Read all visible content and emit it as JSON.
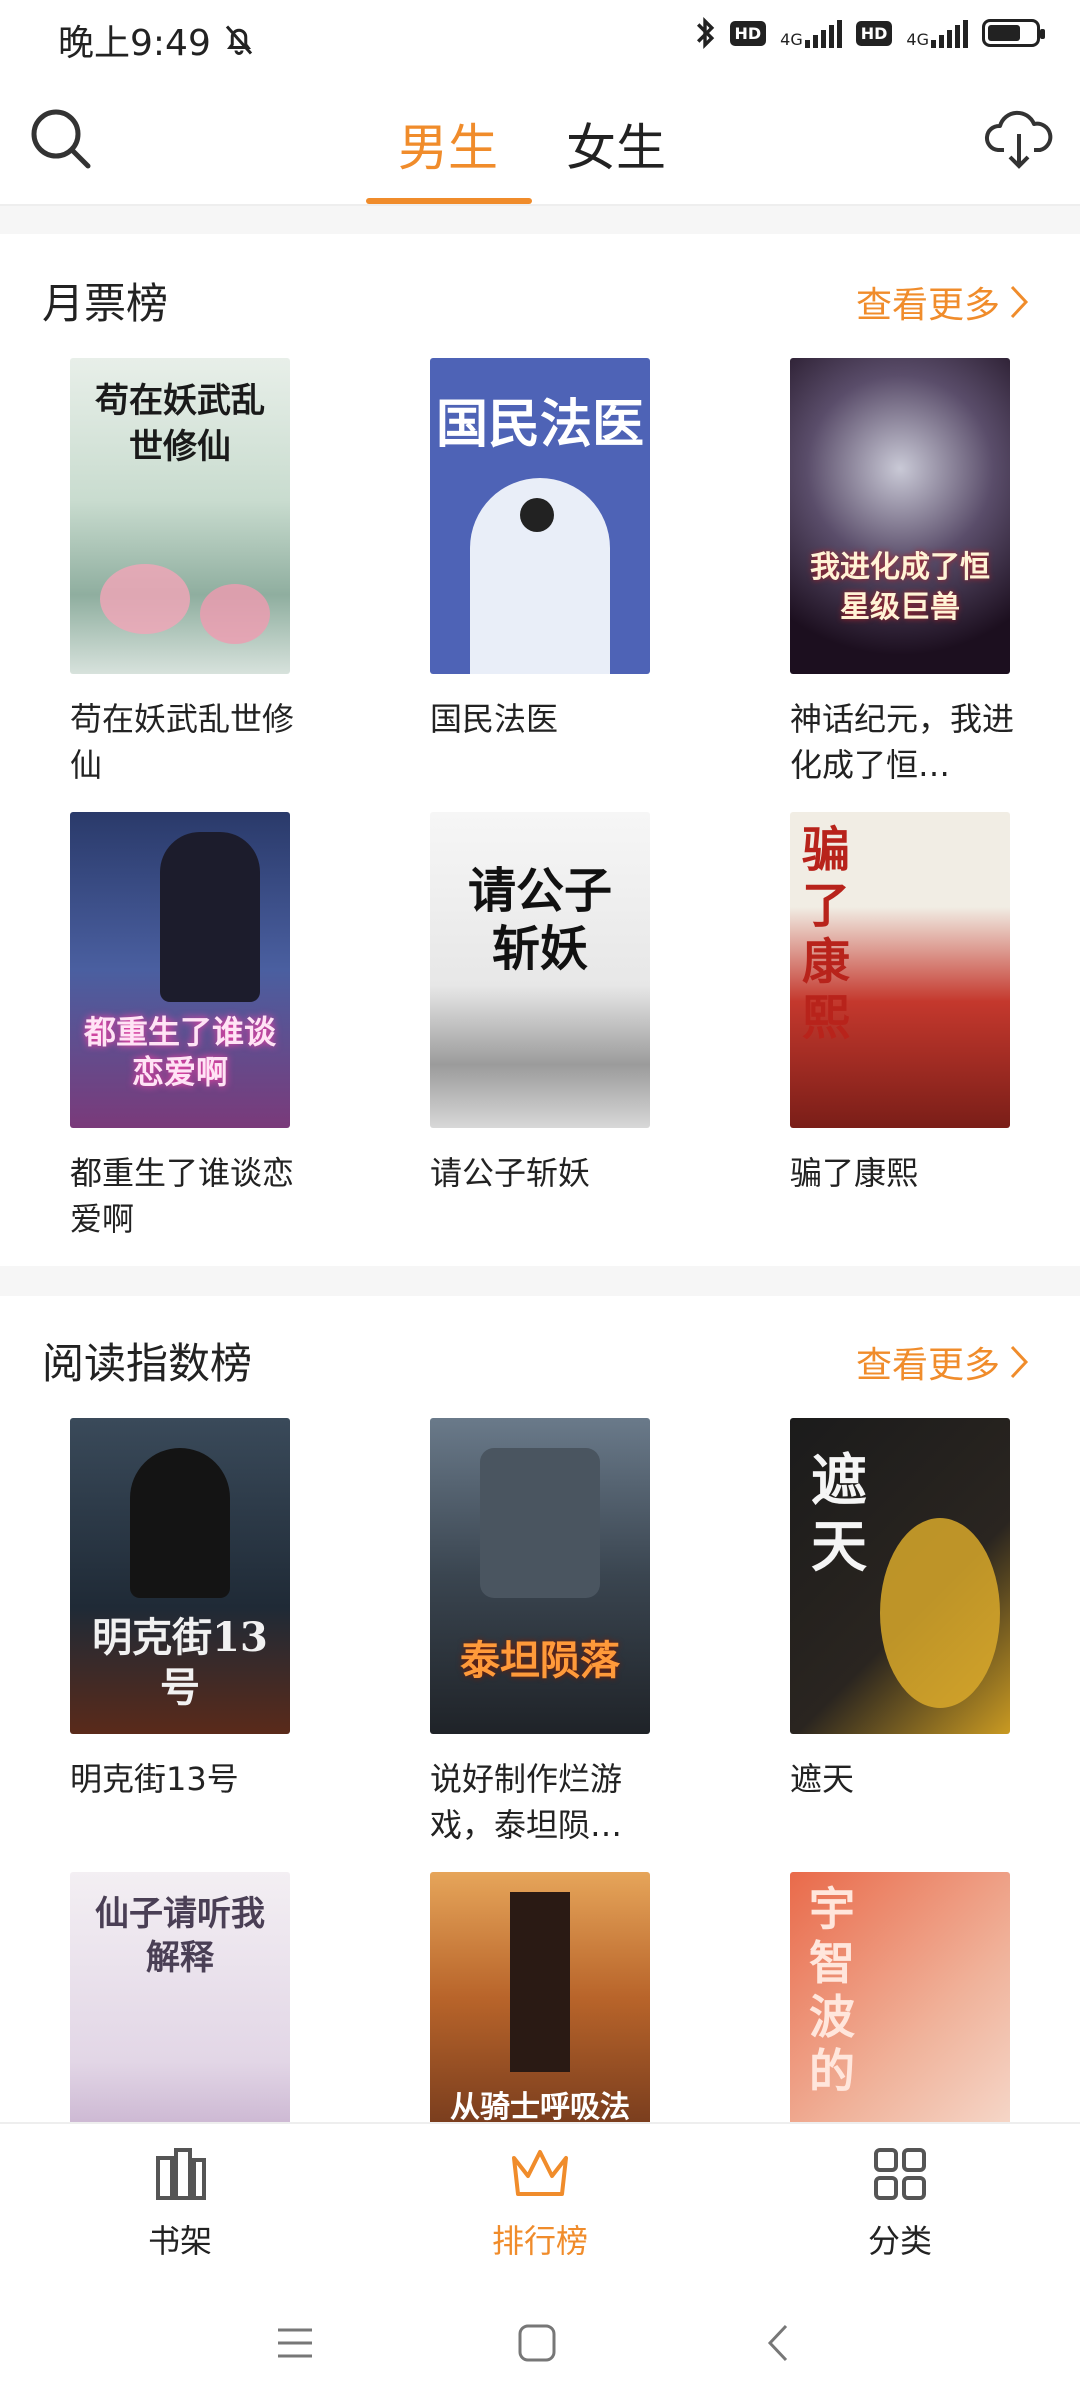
{
  "status": {
    "time": "晚上9:49",
    "hd1": "HD",
    "net1": "4G",
    "hd2": "HD",
    "net2": "4G",
    "battery_level": 0.7
  },
  "top_nav": {
    "tabs": [
      {
        "label": "男生",
        "active": true
      },
      {
        "label": "女生",
        "active": false
      }
    ],
    "accent": "#f08c2b"
  },
  "sections": [
    {
      "title": "月票榜",
      "more": "查看更多",
      "books": [
        {
          "title": "苟在妖武乱世修仙",
          "cover_text": "苟在妖武乱世修仙"
        },
        {
          "title": "国民法医",
          "cover_text": "国民法医"
        },
        {
          "title": "神话纪元，我进化成了恒…",
          "cover_text": "我进化成了恒星级巨兽"
        },
        {
          "title": "都重生了谁谈恋爱啊",
          "cover_text": "都重生了谁谈恋爱啊"
        },
        {
          "title": "请公子斩妖",
          "cover_text": "请公子斩妖"
        },
        {
          "title": "骗了康熙",
          "cover_text": "骗了康熙"
        }
      ]
    },
    {
      "title": "阅读指数榜",
      "more": "查看更多",
      "books": [
        {
          "title": "明克街13号",
          "cover_text": "明克街13号"
        },
        {
          "title": "说好制作烂游戏，泰坦陨…",
          "cover_text": "泰坦陨落"
        },
        {
          "title": "遮天",
          "cover_text": "遮天"
        },
        {
          "title": "",
          "cover_text": "仙子请听我解释"
        },
        {
          "title": "",
          "cover_text": "从骑士呼吸法"
        },
        {
          "title": "",
          "cover_text": "宇智波的"
        }
      ]
    }
  ],
  "bottom_nav": [
    {
      "label": "书架",
      "icon": "bookshelf-icon",
      "active": false
    },
    {
      "label": "排行榜",
      "icon": "crown-icon",
      "active": true
    },
    {
      "label": "分类",
      "icon": "grid-icon",
      "active": false
    }
  ]
}
